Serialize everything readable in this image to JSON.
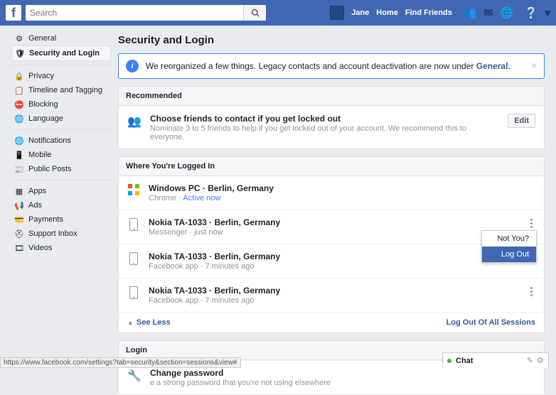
{
  "topbar": {
    "search_placeholder": "Search",
    "user_name": "Jane",
    "home": "Home",
    "find_friends": "Find Friends"
  },
  "sidebar": {
    "g1": [
      {
        "icon": "⚙",
        "label": "General"
      },
      {
        "icon": "🛡",
        "label": "Security and Login",
        "active": true
      }
    ],
    "g2": [
      {
        "icon": "🔒",
        "label": "Privacy"
      },
      {
        "icon": "📋",
        "label": "Timeline and Tagging"
      },
      {
        "icon": "⛔",
        "label": "Blocking"
      },
      {
        "icon": "🌐",
        "label": "Language"
      }
    ],
    "g3": [
      {
        "icon": "🌐",
        "label": "Notifications"
      },
      {
        "icon": "📱",
        "label": "Mobile"
      },
      {
        "icon": "📰",
        "label": "Public Posts"
      }
    ],
    "g4": [
      {
        "icon": "▦",
        "label": "Apps"
      },
      {
        "icon": "📢",
        "label": "Ads"
      },
      {
        "icon": "💳",
        "label": "Payments"
      },
      {
        "icon": "⛑",
        "label": "Support Inbox"
      },
      {
        "icon": "🎞",
        "label": "Videos"
      }
    ]
  },
  "page_title": "Security and Login",
  "notice": {
    "text_a": "We reorganized a few things. Legacy contacts and account deactivation are now under ",
    "link": "General",
    "text_b": "."
  },
  "recommended": {
    "header": "Recommended",
    "title": "Choose friends to contact if you get locked out",
    "sub": "Nominate 3 to 5 friends to help if you get locked out of your account. We recommend this to everyone.",
    "edit": "Edit"
  },
  "sessions": {
    "header": "Where You're Logged In",
    "rows": [
      {
        "device": "Windows PC · Berlin, Germany",
        "app": "Chrome",
        "time": "Active now",
        "active": true,
        "icon": "win"
      },
      {
        "device": "Nokia TA-1033 · Berlin, Germany",
        "app": "Messenger",
        "time": "just now",
        "icon": "phone",
        "menu": true,
        "popup": true
      },
      {
        "device": "Nokia TA-1033 · Berlin, Germany",
        "app": "Facebook app",
        "time": "7 minutes ago",
        "icon": "phone"
      },
      {
        "device": "Nokia TA-1033 · Berlin, Germany",
        "app": "Facebook app",
        "time": "7 minutes ago",
        "icon": "phone",
        "menu": true
      }
    ],
    "popup": {
      "notyou": "Not You?",
      "logout": "Log Out"
    },
    "see_less": "See Less",
    "logout_all": "Log Out Of All Sessions"
  },
  "login": {
    "header": "Login",
    "title": "Change password",
    "sub": "e a strong password that you're not using elsewhere"
  },
  "chat": {
    "label": "Chat"
  },
  "status_url": "https://www.facebook.com/settings?tab=security&section=sessions&view#"
}
